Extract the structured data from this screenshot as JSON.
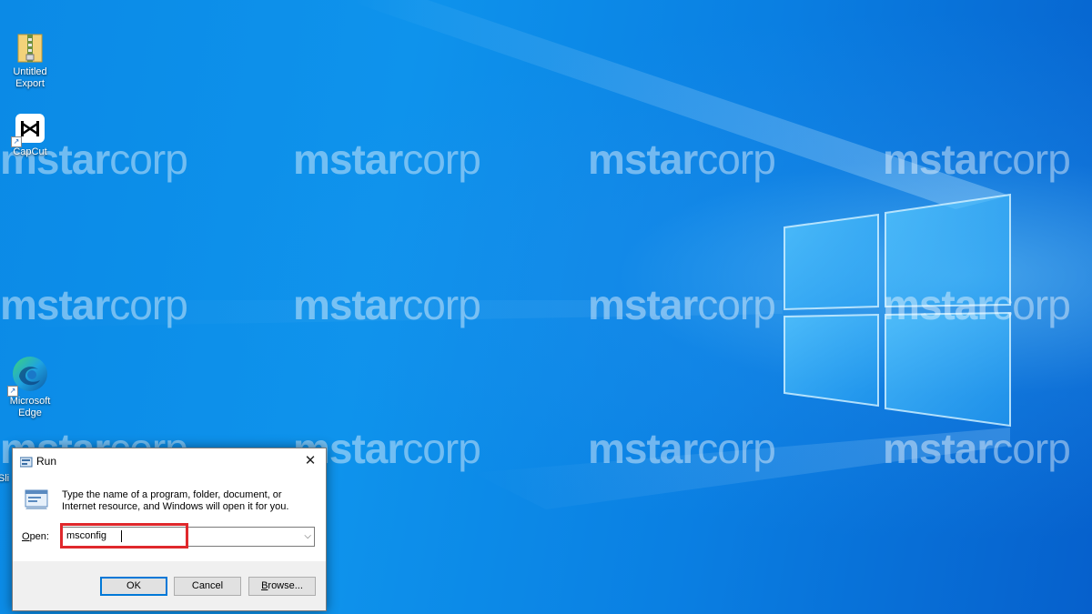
{
  "watermark": {
    "bold_part": "mstar",
    "light_part": "corp"
  },
  "desktop_icons": [
    {
      "label_line1": "Untitled",
      "label_line2": "Export",
      "icon": "archive-folder-icon"
    },
    {
      "label_line1": "CapCut",
      "label_line2": "",
      "icon": "capcut-icon"
    },
    {
      "label_line1": "Microsoft",
      "label_line2": "Edge",
      "icon": "edge-icon"
    },
    {
      "label_line1": "Sli",
      "label_line2": "",
      "icon": "partial-icon"
    }
  ],
  "run_dialog": {
    "title": "Run",
    "close_glyph": "✕",
    "description": "Type the name of a program, folder, document, or Internet resource, and Windows will open it for you.",
    "open_label_first": "O",
    "open_label_rest": "pen:",
    "open_value": "msconfig",
    "combo_arrow": "⌵",
    "ok_label": "OK",
    "cancel_label": "Cancel",
    "browse_label_first": "B",
    "browse_label_rest": "rowse...",
    "accent_color": "#0078d7",
    "highlight_color": "#e0282c"
  },
  "colors": {
    "desktop_blue": "#0a78d8"
  }
}
